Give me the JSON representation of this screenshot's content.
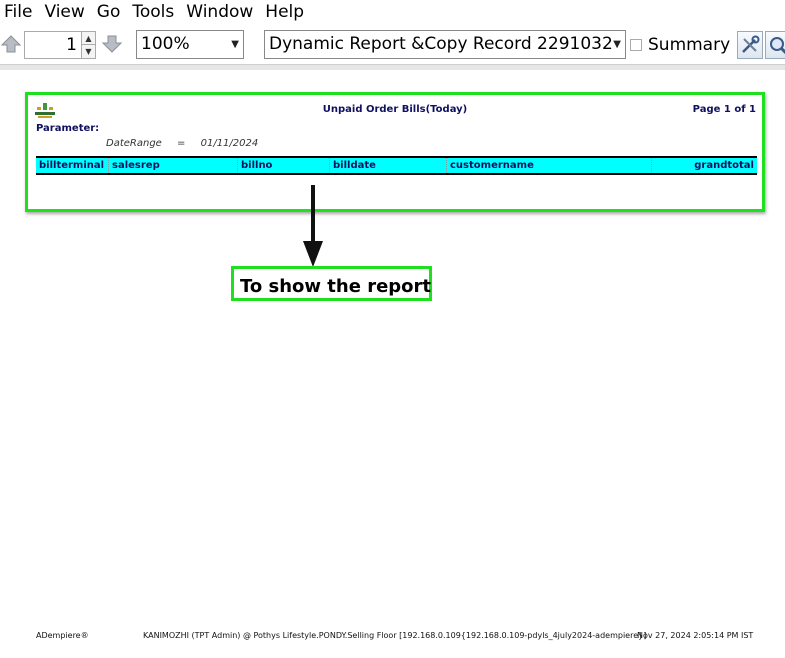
{
  "menu": {
    "file": "File",
    "view": "View",
    "go": "Go",
    "tools": "Tools",
    "window": "Window",
    "help": "Help"
  },
  "toolbar": {
    "page_number": "1",
    "zoom": "100%",
    "report_name": "Dynamic Report &Copy Record 2291032",
    "summary_label": "Summary"
  },
  "report": {
    "title": "Unpaid Order Bills(Today)",
    "page_info": "Page 1 of 1",
    "parameter_label": "Parameter:",
    "param_name": "DateRange",
    "param_op": "=",
    "param_value": "01/11/2024",
    "columns": [
      "billterminal",
      "salesrep",
      "billno",
      "billdate",
      "customername",
      "grandtotal"
    ]
  },
  "annotation": {
    "callout": "To show the report"
  },
  "status": {
    "app": "ADempiere®",
    "context": "KANIMOZHI (TPT Admin) @ Pothys Lifestyle.PONDY.Selling Floor [192.168.0.109{192.168.0.109-pdyls_4july2024-adempiere}]",
    "datetime": "Nov 27, 2024 2:05:14 PM IST"
  },
  "colors": {
    "highlight": "#1ee01e",
    "header_bg": "#00ffff"
  }
}
